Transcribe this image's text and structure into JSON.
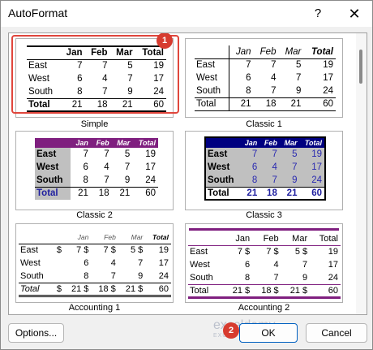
{
  "window": {
    "title": "AutoFormat",
    "help_glyph": "?",
    "close_glyph": "✕"
  },
  "formats": [
    {
      "name": "Simple",
      "columns": [
        "",
        "Jan",
        "Feb",
        "Mar",
        "Total"
      ],
      "rows": [
        [
          "East",
          "7",
          "7",
          "5",
          "19"
        ],
        [
          "West",
          "6",
          "4",
          "7",
          "17"
        ],
        [
          "South",
          "8",
          "7",
          "9",
          "24"
        ],
        [
          "Total",
          "21",
          "18",
          "21",
          "60"
        ]
      ]
    },
    {
      "name": "Classic 1",
      "columns": [
        "",
        "Jan",
        "Feb",
        "Mar",
        "Total"
      ],
      "rows": [
        [
          "East",
          "7",
          "7",
          "5",
          "19"
        ],
        [
          "West",
          "6",
          "4",
          "7",
          "17"
        ],
        [
          "South",
          "8",
          "7",
          "9",
          "24"
        ],
        [
          "Total",
          "21",
          "18",
          "21",
          "60"
        ]
      ]
    },
    {
      "name": "Classic 2",
      "columns": [
        "",
        "Jan",
        "Feb",
        "Mar",
        "Total"
      ],
      "rows": [
        [
          "East",
          "7",
          "7",
          "5",
          "19"
        ],
        [
          "West",
          "6",
          "4",
          "7",
          "17"
        ],
        [
          "South",
          "8",
          "7",
          "9",
          "24"
        ],
        [
          "Total",
          "21",
          "18",
          "21",
          "60"
        ]
      ]
    },
    {
      "name": "Classic 3",
      "columns": [
        "",
        "Jan",
        "Feb",
        "Mar",
        "Total"
      ],
      "rows": [
        [
          "East",
          "7",
          "7",
          "5",
          "19"
        ],
        [
          "West",
          "6",
          "4",
          "7",
          "17"
        ],
        [
          "South",
          "8",
          "7",
          "9",
          "24"
        ],
        [
          "Total",
          "21",
          "18",
          "21",
          "60"
        ]
      ]
    },
    {
      "name": "Accounting 1",
      "columns": [
        "",
        "Jan",
        "Feb",
        "Mar",
        "Total"
      ],
      "rows": [
        [
          "East",
          "$",
          "7 $",
          "7 $",
          "5 $",
          "19"
        ],
        [
          "West",
          "",
          "6",
          "4",
          "7",
          "17"
        ],
        [
          "South",
          "",
          "8",
          "7",
          "9",
          "24"
        ],
        [
          "Total",
          "$",
          "21 $",
          "18 $",
          "21 $",
          "60"
        ]
      ]
    },
    {
      "name": "Accounting 2",
      "columns": [
        "",
        "Jan",
        "Feb",
        "Mar",
        "Total"
      ],
      "rows": [
        [
          "East",
          "7 $",
          "7 $",
          "5 $",
          "19"
        ],
        [
          "West",
          "6",
          "4",
          "7",
          "17"
        ],
        [
          "South",
          "8",
          "7",
          "9",
          "24"
        ],
        [
          "Total",
          "21 $",
          "18 $",
          "21 $",
          "60"
        ]
      ]
    }
  ],
  "selected_format": "Simple",
  "badges": {
    "first": "1",
    "second": "2"
  },
  "buttons": {
    "options": "Options...",
    "ok": "OK",
    "cancel": "Cancel"
  },
  "watermark": {
    "brand": "exceldemy",
    "tagline": "EXCEL · DATA · BI"
  },
  "colors": {
    "selection": "#e0463c",
    "classic2_header": "#7f1f7f",
    "classic3_header": "#000080"
  }
}
